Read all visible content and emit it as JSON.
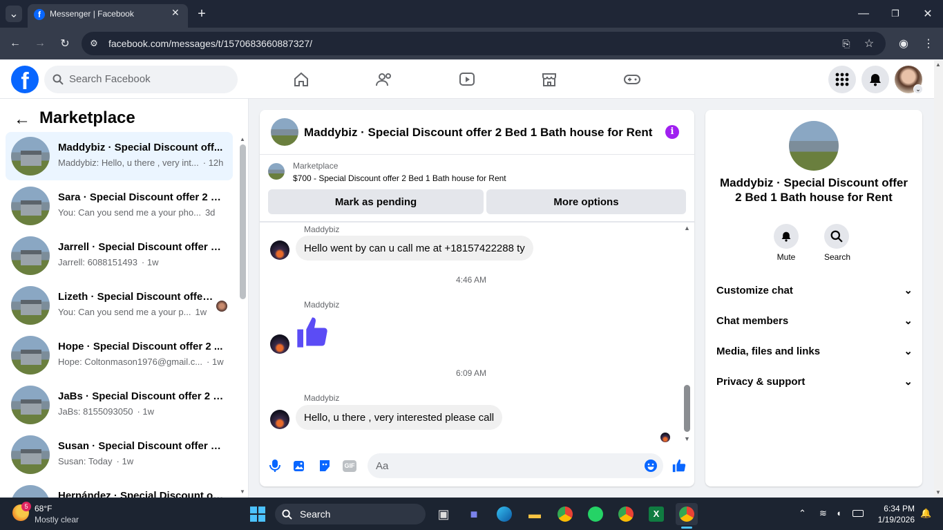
{
  "browser": {
    "tab_title": "Messenger | Facebook",
    "url": "facebook.com/messages/t/1570683660887327/"
  },
  "header": {
    "search_placeholder": "Search Facebook"
  },
  "sidebar": {
    "title": "Marketplace",
    "conversations": [
      {
        "title": "Maddybiz · Special Discount off...",
        "preview": "Maddybiz: Hello, u there , very int...",
        "time": "· 12h"
      },
      {
        "title": "Sara · Special Discount offer 2 B...",
        "preview": "You: Can you send me a your pho...",
        "time": "3d"
      },
      {
        "title": "Jarrell · Special Discount offer 2 ...",
        "preview": "Jarrell: 6088151493",
        "time": "· 1w"
      },
      {
        "title": "Lizeth · Special Discount offer ...",
        "preview": "You: Can you send me a your p...",
        "time": "1w"
      },
      {
        "title": "Hope · Special Discount offer 2 ...",
        "preview": "Hope: Coltonmason1976@gmail.c...",
        "time": "· 1w"
      },
      {
        "title": "JaBs · Special Discount offer 2 B...",
        "preview": "JaBs: 8155093050",
        "time": "· 1w"
      },
      {
        "title": "Susan · Special Discount offer 2 ...",
        "preview": "Susan: Today",
        "time": "· 1w"
      },
      {
        "title": "Hernández · Special Discount of...",
        "preview": "",
        "time": ""
      }
    ]
  },
  "chat": {
    "title": "Maddybiz · Special Discount offer 2 Bed 1 Bath house for Rent",
    "listing_label": "Marketplace",
    "listing_desc": "$700 - Special Discount offer 2 Bed 1 Bath house for Rent",
    "mark_pending": "Mark as pending",
    "more_options": "More options",
    "sender": "Maddybiz",
    "msg1": "Hello went by can u call me at +18157422288 ty",
    "time1": "4:46 AM",
    "time2": "6:09 AM",
    "msg3": "Hello, u there , very interested please call",
    "composer_placeholder": "Aa",
    "accent": "#0866ff"
  },
  "info": {
    "name": "Maddybiz · Special Discount offer 2 Bed 1 Bath house for Rent",
    "mute": "Mute",
    "search": "Search",
    "sections": [
      "Customize chat",
      "Chat members",
      "Media, files and links",
      "Privacy & support"
    ]
  },
  "taskbar": {
    "weather_badge": "5",
    "temp": "68°F",
    "condition": "Mostly clear",
    "search": "Search",
    "time": "6:34 PM",
    "date": "1/19/2026"
  }
}
